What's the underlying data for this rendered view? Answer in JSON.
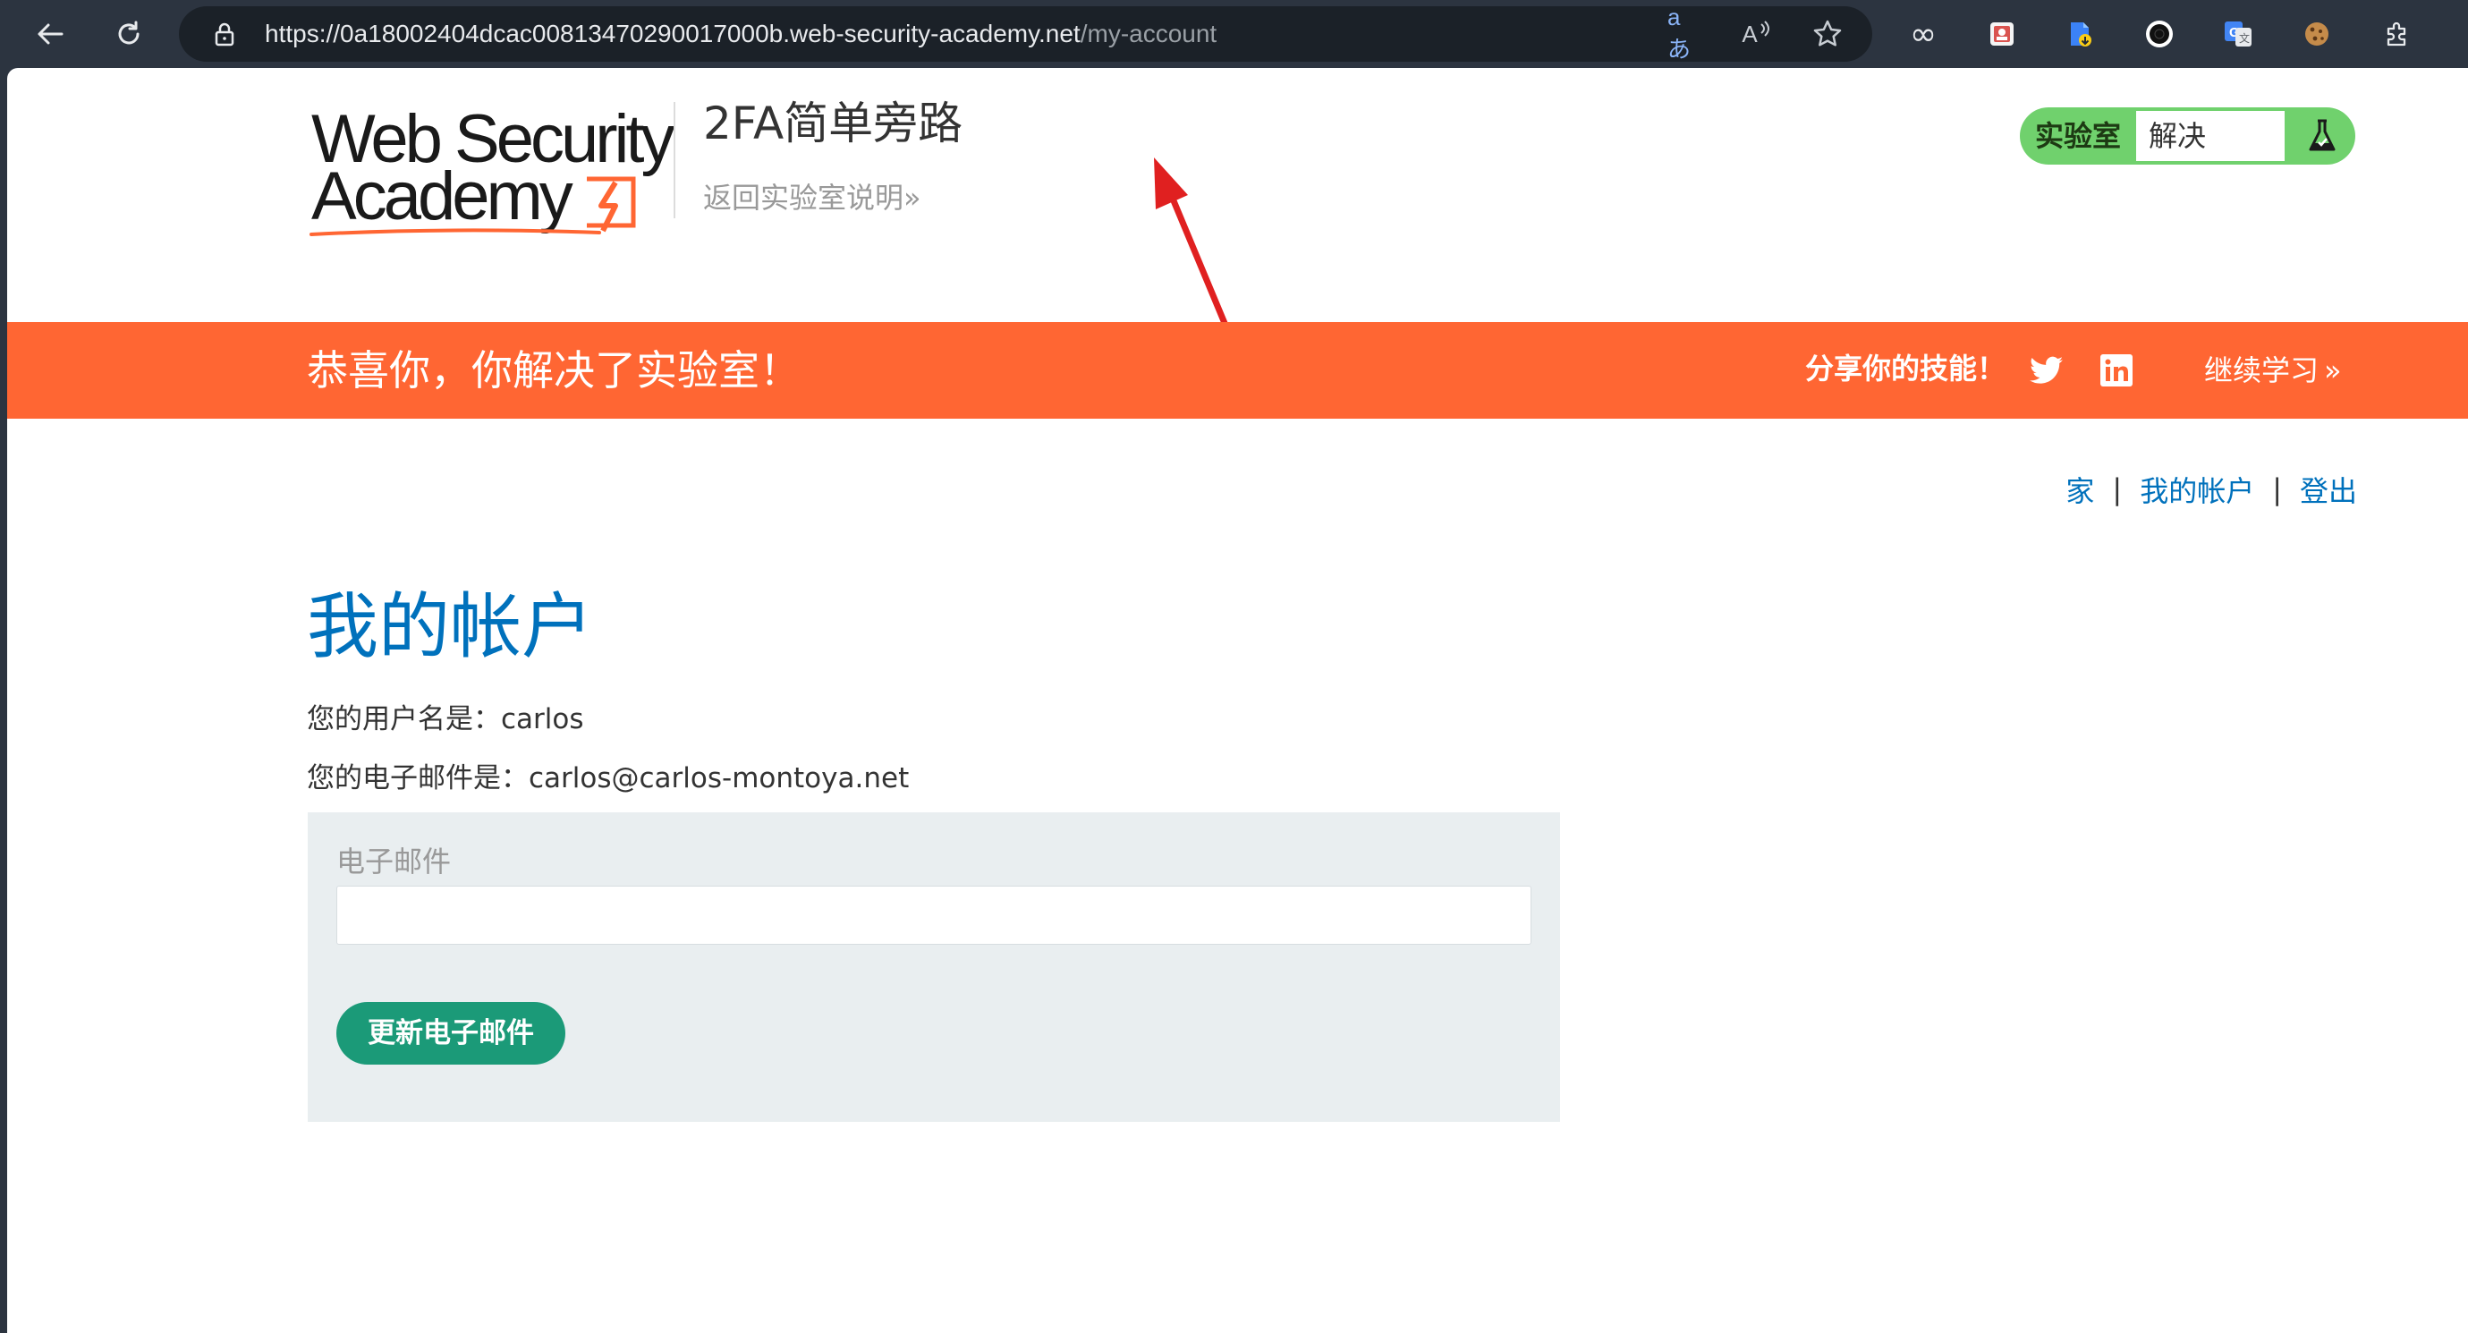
{
  "browser": {
    "url_host": "https://0a18002404dcac00813470290017000b.web-security-academy.net",
    "url_path": "/my-account",
    "icons": [
      "back-icon",
      "refresh-icon",
      "lock-icon",
      "translate-icon",
      "read-aloud-icon",
      "favorite-star-icon",
      "infinity-extension-icon",
      "extension-icon",
      "extension-icon",
      "extension-icon",
      "translate-extension-icon",
      "cookie-extension-icon",
      "extensions-puzzle-icon"
    ],
    "translate_glyph": "aあ",
    "read_aloud_glyph": "A",
    "infinity_glyph": "∞"
  },
  "header": {
    "logo_line1": "Web Security",
    "logo_line2": "Academy",
    "lab_title": "2FA简单旁路",
    "back_link": "返回实验室说明",
    "back_chevron": "»",
    "lab_status_label": "实验室",
    "lab_status_value": "解决",
    "lab_status_icon": "flask-icon"
  },
  "banner": {
    "message": "恭喜你，你解决了实验室！",
    "share": "分享你的技能！",
    "continue": "继续学习",
    "continue_chevron": "»",
    "social_icons": [
      "twitter-icon",
      "linkedin-icon"
    ]
  },
  "nav": {
    "home": "家",
    "separator": "|",
    "my_account": "我的帐户",
    "logout": "登出"
  },
  "content": {
    "heading": "我的帐户",
    "username_line": "您的用户名是：carlos",
    "email_line": "您的电子邮件是：carlos@carlos-montoya.net"
  },
  "form": {
    "email_label": "电子邮件",
    "email_value": "",
    "submit_label": "更新电子邮件"
  },
  "colors": {
    "banner": "#ff6633",
    "link": "#0071bc",
    "status_green": "#70d16d",
    "button": "#1b9a78",
    "annotation_arrow": "#e02020"
  }
}
